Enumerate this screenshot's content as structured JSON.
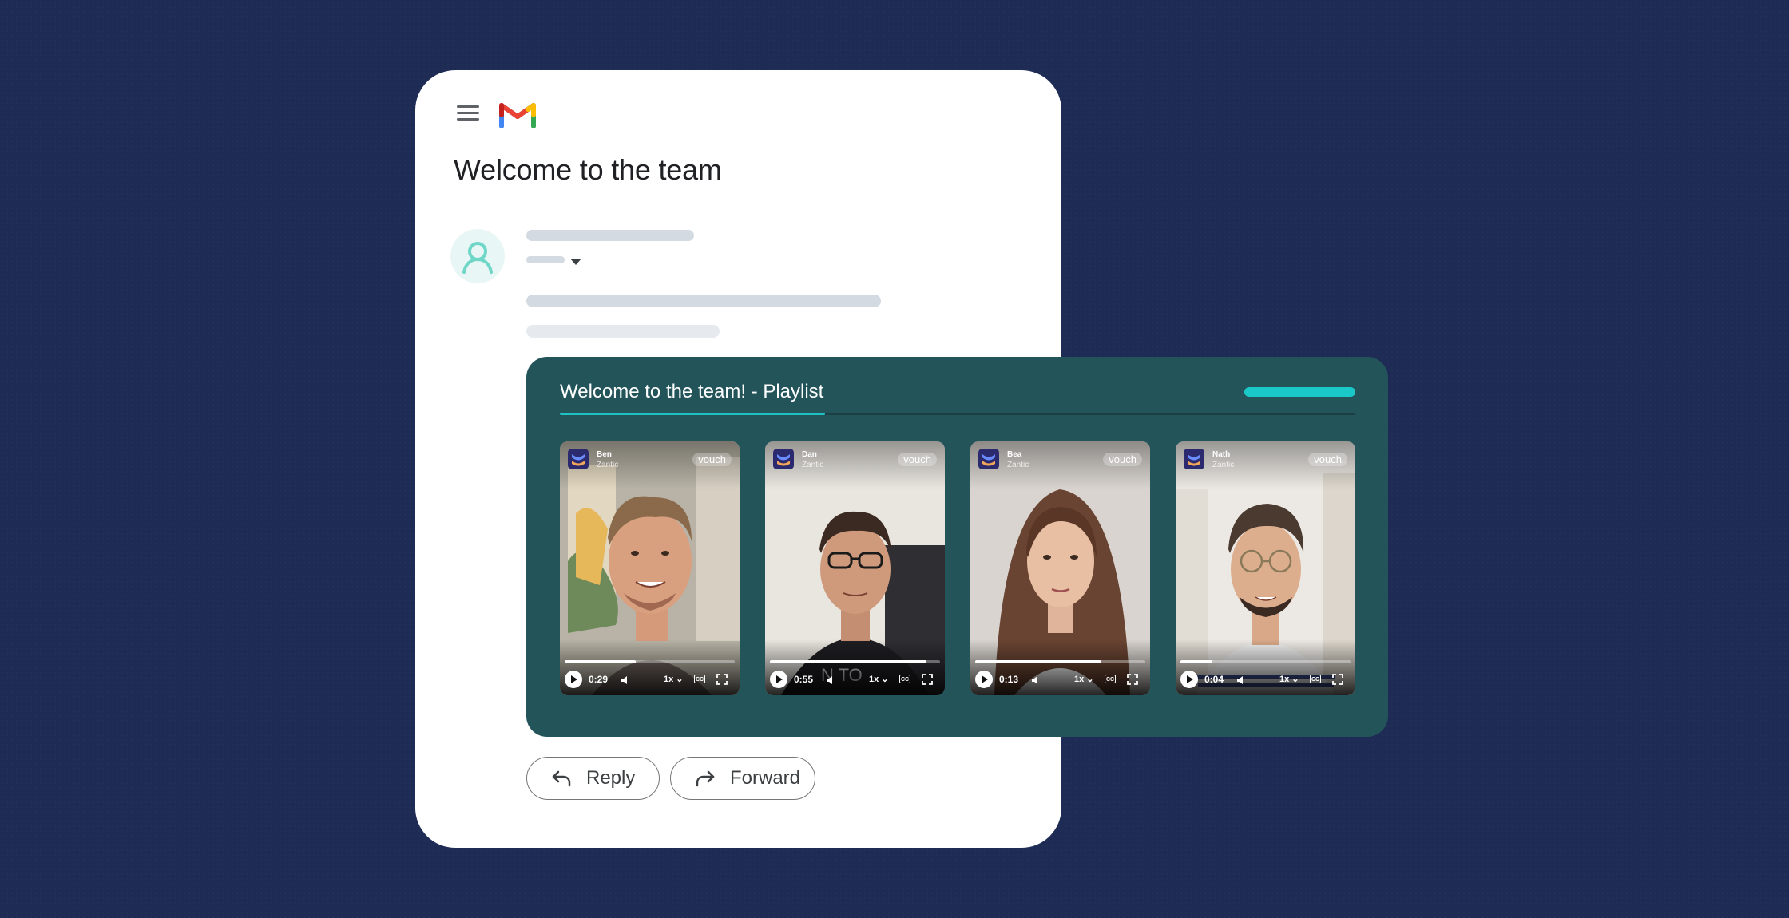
{
  "mail": {
    "title": "Welcome to the team",
    "reply_label": "Reply",
    "forward_label": "Forward"
  },
  "playlist": {
    "title": "Welcome to the team! - Playlist",
    "videos": [
      {
        "name": "Ben",
        "company": "Zantic",
        "badge": "vouch",
        "time": "0:29",
        "speed": "1x",
        "progress": 0.42,
        "cc": "CC"
      },
      {
        "name": "Dan",
        "company": "Zantic",
        "badge": "vouch",
        "time": "0:55",
        "speed": "1x",
        "progress": 0.92,
        "cc": "CC"
      },
      {
        "name": "Bea",
        "company": "Zantic",
        "badge": "vouch",
        "time": "0:13",
        "speed": "1x",
        "progress": 0.74,
        "cc": "CC"
      },
      {
        "name": "Nath",
        "company": "Zantic",
        "badge": "vouch",
        "time": "0:04",
        "speed": "1x",
        "progress": 0.19,
        "cc": "CC"
      }
    ]
  },
  "colors": {
    "background": "#1e2b54",
    "panel": "#22545a",
    "accent": "#1fc2c3"
  }
}
